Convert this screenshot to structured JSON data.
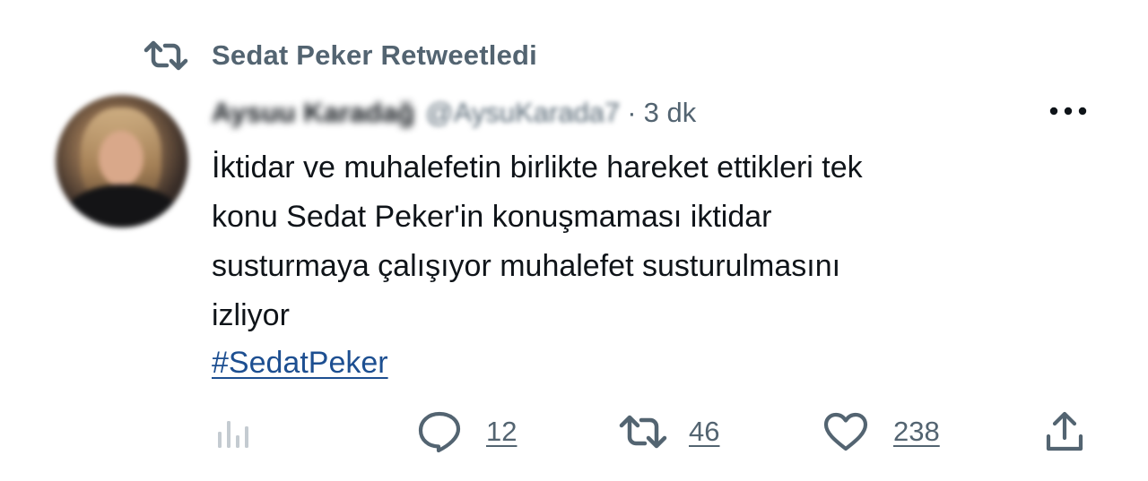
{
  "retweet_context": {
    "label": "Sedat Peker Retweetledi",
    "icon": "retweet-icon"
  },
  "tweet": {
    "author": {
      "display_name": "Aysuu Karadağ",
      "handle": "@AysuKarada7",
      "avatar_icon": "user-avatar"
    },
    "separator": "·",
    "time": "3 dk",
    "more_icon": "more-horizontal-icon",
    "text_lines": [
      "İktidar ve muhalefetin birlikte hareket ettikleri tek",
      "konu Sedat Peker'in konuşmaması iktidar",
      "susturmaya çalışıyor muhalefet susturulmasını",
      "izliyor"
    ],
    "hashtag": "#SedatPeker"
  },
  "actions": {
    "analytics": {
      "icon": "analytics-icon"
    },
    "reply": {
      "icon": "reply-icon",
      "count": "12"
    },
    "retweet": {
      "icon": "retweet-icon",
      "count": "46"
    },
    "like": {
      "icon": "heart-icon",
      "count": "238"
    },
    "share": {
      "icon": "share-icon"
    }
  },
  "colors": {
    "text_primary": "#0f1419",
    "text_secondary": "#536471",
    "hashtag": "#1d4f91",
    "background": "#ffffff"
  }
}
